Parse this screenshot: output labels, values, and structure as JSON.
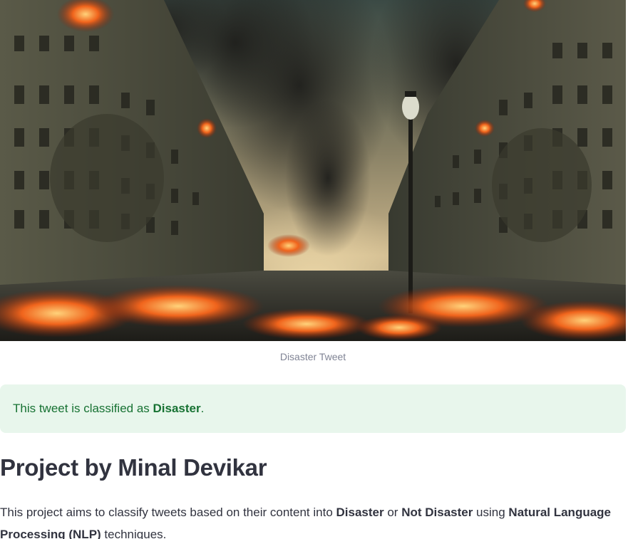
{
  "hero_image": {
    "alt": "Disaster Tweet",
    "caption": "Disaster Tweet",
    "icon": "burning-city-street-image"
  },
  "alert": {
    "prefix": "This tweet is classified as ",
    "label": "Disaster",
    "suffix": ".",
    "color": "#177233",
    "background": "#e8f6ec"
  },
  "heading": {
    "title": "Project by Minal Devikar"
  },
  "description": {
    "part1": "This project aims to classify tweets based on their content into ",
    "term1": "Disaster",
    "part2": " or ",
    "term2": "Not Disaster",
    "part3": " using ",
    "term3": "Natural Language Processing (NLP)",
    "part4": " techniques."
  }
}
